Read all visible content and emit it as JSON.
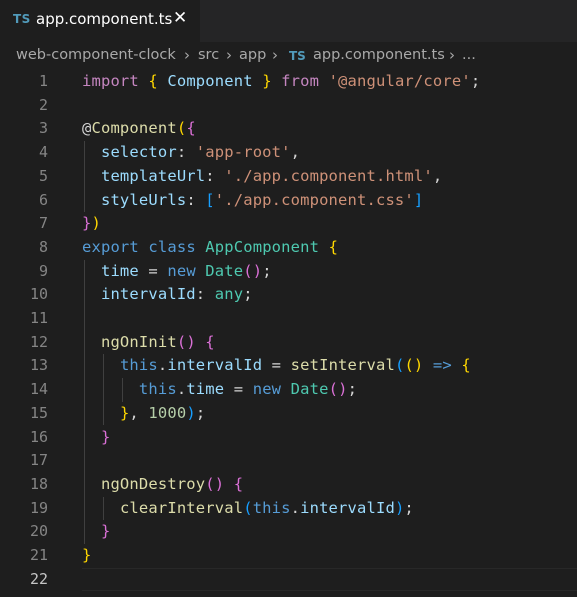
{
  "tab": {
    "icon": "TS",
    "label": "app.component.ts",
    "close": "✕"
  },
  "breadcrumb": {
    "items": [
      "web-component-clock",
      "src",
      "app",
      "app.component.ts",
      "..."
    ],
    "separator": "›",
    "file_icon": "TS"
  },
  "editor": {
    "line_numbers": [
      "1",
      "2",
      "3",
      "4",
      "5",
      "6",
      "7",
      "8",
      "9",
      "10",
      "11",
      "12",
      "13",
      "14",
      "15",
      "16",
      "17",
      "18",
      "19",
      "20",
      "21",
      "22"
    ],
    "current_line": "22",
    "lines": [
      [
        [
          "ctrl",
          "import"
        ],
        [
          "plain",
          " "
        ],
        [
          "b1",
          "{"
        ],
        [
          "plain",
          " "
        ],
        [
          "var",
          "Component"
        ],
        [
          "plain",
          " "
        ],
        [
          "b1",
          "}"
        ],
        [
          "plain",
          " "
        ],
        [
          "ctrl",
          "from"
        ],
        [
          "plain",
          " "
        ],
        [
          "str",
          "'@angular/core'"
        ],
        [
          "plain",
          ";"
        ]
      ],
      [],
      [
        [
          "plain",
          "@"
        ],
        [
          "fn",
          "Component"
        ],
        [
          "b1",
          "("
        ],
        [
          "b2",
          "{"
        ]
      ],
      [
        [
          "plain",
          "  "
        ],
        [
          "var",
          "selector"
        ],
        [
          "plain",
          ": "
        ],
        [
          "str",
          "'app-root'"
        ],
        [
          "plain",
          ","
        ]
      ],
      [
        [
          "plain",
          "  "
        ],
        [
          "var",
          "templateUrl"
        ],
        [
          "plain",
          ": "
        ],
        [
          "str",
          "'./app.component.html'"
        ],
        [
          "plain",
          ","
        ]
      ],
      [
        [
          "plain",
          "  "
        ],
        [
          "var",
          "styleUrls"
        ],
        [
          "plain",
          ": "
        ],
        [
          "b3",
          "["
        ],
        [
          "str",
          "'./app.component.css'"
        ],
        [
          "b3",
          "]"
        ]
      ],
      [
        [
          "b2",
          "}"
        ],
        [
          "b1",
          ")"
        ]
      ],
      [
        [
          "kw",
          "export"
        ],
        [
          "plain",
          " "
        ],
        [
          "kw",
          "class"
        ],
        [
          "plain",
          " "
        ],
        [
          "cls",
          "AppComponent"
        ],
        [
          "plain",
          " "
        ],
        [
          "b1",
          "{"
        ]
      ],
      [
        [
          "plain",
          "  "
        ],
        [
          "var",
          "time"
        ],
        [
          "plain",
          " = "
        ],
        [
          "kw",
          "new"
        ],
        [
          "plain",
          " "
        ],
        [
          "cls",
          "Date"
        ],
        [
          "b2",
          "("
        ],
        [
          "b2",
          ")"
        ],
        [
          "plain",
          ";"
        ]
      ],
      [
        [
          "plain",
          "  "
        ],
        [
          "var",
          "intervalId"
        ],
        [
          "plain",
          ": "
        ],
        [
          "cls",
          "any"
        ],
        [
          "plain",
          ";"
        ]
      ],
      [],
      [
        [
          "plain",
          "  "
        ],
        [
          "fn",
          "ngOnInit"
        ],
        [
          "b2",
          "("
        ],
        [
          "b2",
          ")"
        ],
        [
          "plain",
          " "
        ],
        [
          "b2",
          "{"
        ]
      ],
      [
        [
          "plain",
          "    "
        ],
        [
          "kw",
          "this"
        ],
        [
          "plain",
          "."
        ],
        [
          "var",
          "intervalId"
        ],
        [
          "plain",
          " = "
        ],
        [
          "fn",
          "setInterval"
        ],
        [
          "b3",
          "("
        ],
        [
          "b1",
          "("
        ],
        [
          "b1",
          ")"
        ],
        [
          "plain",
          " "
        ],
        [
          "kw",
          "=>"
        ],
        [
          "plain",
          " "
        ],
        [
          "b1",
          "{"
        ]
      ],
      [
        [
          "plain",
          "      "
        ],
        [
          "kw",
          "this"
        ],
        [
          "plain",
          "."
        ],
        [
          "var",
          "time"
        ],
        [
          "plain",
          " = "
        ],
        [
          "kw",
          "new"
        ],
        [
          "plain",
          " "
        ],
        [
          "cls",
          "Date"
        ],
        [
          "b2",
          "("
        ],
        [
          "b2",
          ")"
        ],
        [
          "plain",
          ";"
        ]
      ],
      [
        [
          "plain",
          "    "
        ],
        [
          "b1",
          "}"
        ],
        [
          "plain",
          ", "
        ],
        [
          "num",
          "1000"
        ],
        [
          "b3",
          ")"
        ],
        [
          "plain",
          ";"
        ]
      ],
      [
        [
          "plain",
          "  "
        ],
        [
          "b2",
          "}"
        ]
      ],
      [],
      [
        [
          "plain",
          "  "
        ],
        [
          "fn",
          "ngOnDestroy"
        ],
        [
          "b2",
          "("
        ],
        [
          "b2",
          ")"
        ],
        [
          "plain",
          " "
        ],
        [
          "b2",
          "{"
        ]
      ],
      [
        [
          "plain",
          "    "
        ],
        [
          "fn",
          "clearInterval"
        ],
        [
          "b3",
          "("
        ],
        [
          "kw",
          "this"
        ],
        [
          "plain",
          "."
        ],
        [
          "var",
          "intervalId"
        ],
        [
          "b3",
          ")"
        ],
        [
          "plain",
          ";"
        ]
      ],
      [
        [
          "plain",
          "  "
        ],
        [
          "b2",
          "}"
        ]
      ],
      [
        [
          "b1",
          "}"
        ]
      ],
      []
    ]
  },
  "colors": {
    "background": "#1e1e1e",
    "tab_strip": "#252526",
    "keyword_blue": "#569cd6",
    "keyword_control": "#c586c0",
    "string": "#ce9178",
    "number": "#b5cea8",
    "variable": "#9cdcfe",
    "function": "#dcdcaa",
    "type": "#4ec9b0",
    "bracket_gold": "#ffd700",
    "bracket_orchid": "#da70d6",
    "bracket_blue": "#179fff",
    "ts_icon": "#519aba"
  }
}
